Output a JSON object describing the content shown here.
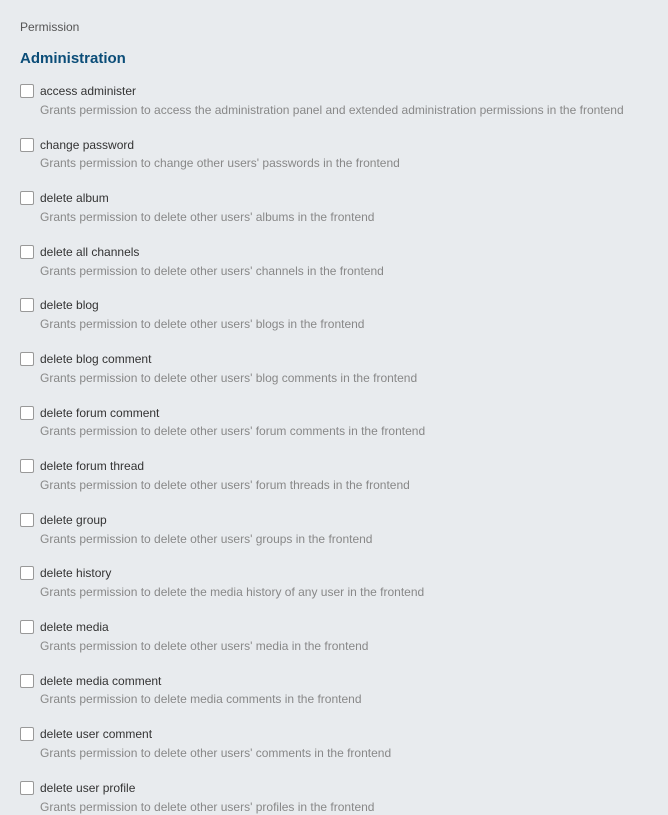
{
  "header": {
    "label": "Permission"
  },
  "section": {
    "title": "Administration"
  },
  "permissions": [
    {
      "name": "access administer",
      "desc": "Grants permission to access the administration panel and extended administration permissions in the frontend"
    },
    {
      "name": "change password",
      "desc": "Grants permission to change other users' passwords in the frontend"
    },
    {
      "name": "delete album",
      "desc": "Grants permission to delete other users' albums in the frontend"
    },
    {
      "name": "delete all channels",
      "desc": "Grants permission to delete other users' channels in the frontend"
    },
    {
      "name": "delete blog",
      "desc": "Grants permission to delete other users' blogs in the frontend"
    },
    {
      "name": "delete blog comment",
      "desc": "Grants permission to delete other users' blog comments in the frontend"
    },
    {
      "name": "delete forum comment",
      "desc": "Grants permission to delete other users' forum comments in the frontend"
    },
    {
      "name": "delete forum thread",
      "desc": "Grants permission to delete other users' forum threads in the frontend"
    },
    {
      "name": "delete group",
      "desc": "Grants permission to delete other users' groups in the frontend"
    },
    {
      "name": "delete history",
      "desc": "Grants permission to delete the media history of any user in the frontend"
    },
    {
      "name": "delete media",
      "desc": "Grants permission to delete other users' media in the frontend"
    },
    {
      "name": "delete media comment",
      "desc": "Grants permission to delete media comments in the frontend"
    },
    {
      "name": "delete user comment",
      "desc": "Grants permission to delete other users' comments in the frontend"
    },
    {
      "name": "delete user profile",
      "desc": "Grants permission to delete other users' profiles in the frontend"
    }
  ]
}
